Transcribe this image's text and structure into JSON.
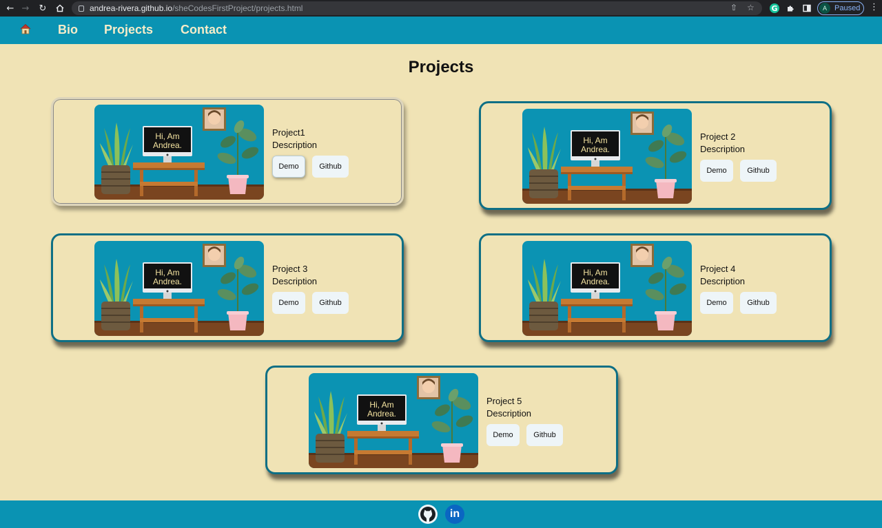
{
  "browser": {
    "url_host": "andrea-rivera.github.io",
    "url_path": "/sheCodesFirstProject/projects.html",
    "profile_initial": "A",
    "profile_status": "Paused"
  },
  "nav": {
    "home_icon": "house-icon",
    "links": [
      "Bio",
      "Projects",
      "Contact"
    ]
  },
  "page": {
    "title": "Projects"
  },
  "projects": [
    {
      "title": "Project1",
      "description": "Description",
      "demo_label": "Demo",
      "github_label": "Github",
      "thumb_text_1": "Hi, Am",
      "thumb_text_2": "Andrea."
    },
    {
      "title": "Project 2",
      "description": "Description",
      "demo_label": "Demo",
      "github_label": "Github",
      "thumb_text_1": "Hi, Am",
      "thumb_text_2": "Andrea."
    },
    {
      "title": "Project 3",
      "description": "Description",
      "demo_label": "Demo",
      "github_label": "Github",
      "thumb_text_1": "Hi, Am",
      "thumb_text_2": "Andrea."
    },
    {
      "title": "Project 4",
      "description": "Description",
      "demo_label": "Demo",
      "github_label": "Github",
      "thumb_text_1": "Hi, Am",
      "thumb_text_2": "Andrea."
    },
    {
      "title": "Project 5",
      "description": "Description",
      "demo_label": "Demo",
      "github_label": "Github",
      "thumb_text_1": "Hi, Am",
      "thumb_text_2": "Andrea."
    }
  ],
  "footer": {
    "icons": [
      "github-icon",
      "linkedin-icon"
    ],
    "linkedin_text": "in"
  },
  "colors": {
    "header": "#0a93b3",
    "background": "#f0e3b5",
    "card_border": "#0e6f85",
    "button_bg": "#eef5f8"
  }
}
